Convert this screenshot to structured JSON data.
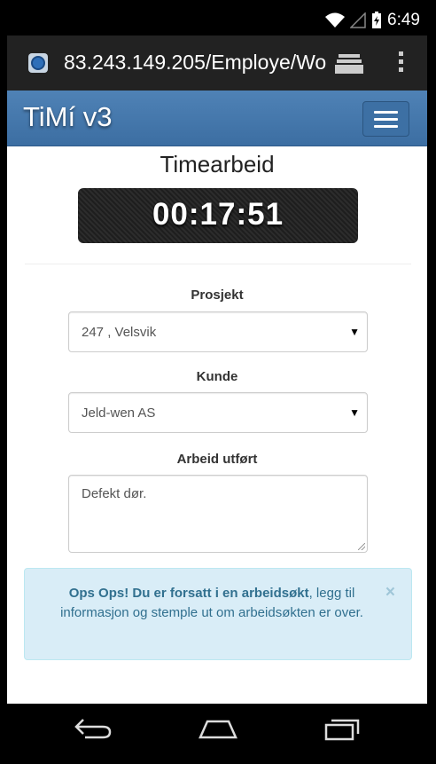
{
  "status": {
    "time": "6:49"
  },
  "browser": {
    "url": "83.243.149.205/Employe/Wo"
  },
  "app": {
    "brand": "TiMí v3"
  },
  "page": {
    "title": "Timearbeid",
    "timer": "00:17:51"
  },
  "form": {
    "project_label": "Prosjekt",
    "project_value": "247 , Velsvik",
    "customer_label": "Kunde",
    "customer_value": "Jeld-wen AS",
    "work_label": "Arbeid utført",
    "work_value": "Defekt dør."
  },
  "alert": {
    "strong": "Ops Ops! Du er forsatt i en arbeidsøkt",
    "text": ", legg til informasjon og stemple ut om arbeidsøkten er over.",
    "close": "×"
  },
  "colors": {
    "navbar": "#4a7db1",
    "alert_bg": "#d9edf7",
    "alert_text": "#31708f"
  }
}
